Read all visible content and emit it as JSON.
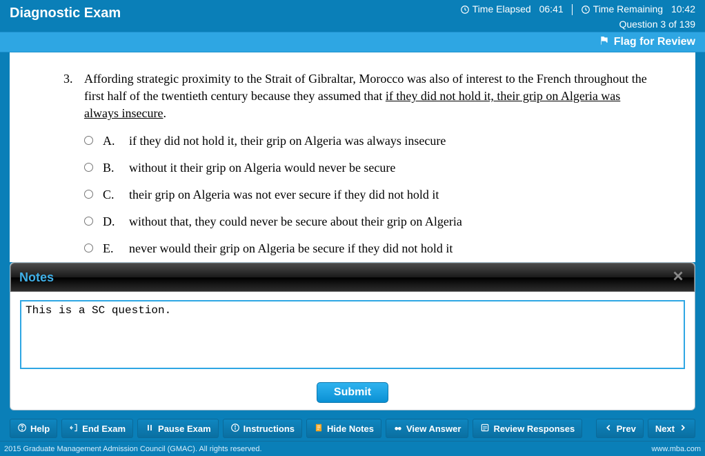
{
  "header": {
    "title": "Diagnostic Exam",
    "time_elapsed_label": "Time Elapsed",
    "time_elapsed_value": "06:41",
    "time_remaining_label": "Time Remaining",
    "time_remaining_value": "10:42",
    "question_counter": "Question 3 of 139"
  },
  "flag_bar": {
    "label": "Flag for Review"
  },
  "question": {
    "number": "3.",
    "stem_pre": "Affording strategic proximity to the Strait of Gibraltar, Morocco was also of interest to the French throughout the first half of the twentieth century because they assumed that ",
    "stem_underlined": "if they did not hold it, their grip on Algeria was always insecure",
    "stem_post": ".",
    "choices": [
      {
        "label": "A.",
        "text": "if they did not hold it, their grip on Algeria was always insecure"
      },
      {
        "label": "B.",
        "text": "without it their grip on Algeria would never be secure"
      },
      {
        "label": "C.",
        "text": "their grip on Algeria was not ever secure if they did not hold it"
      },
      {
        "label": "D.",
        "text": "without that, they could never be secure about their grip on Algeria"
      },
      {
        "label": "E.",
        "text": "never would their grip on Algeria be secure if they did not hold it"
      }
    ]
  },
  "notes": {
    "title": "Notes",
    "content": "This is a SC question.",
    "submit_label": "Submit"
  },
  "toolbar": {
    "help": "Help",
    "end_exam": "End Exam",
    "pause_exam": "Pause Exam",
    "instructions": "Instructions",
    "hide_notes": "Hide Notes",
    "view_answer": "View Answer",
    "review_responses": "Review Responses",
    "prev": "Prev",
    "next": "Next"
  },
  "footer": {
    "copyright": "2015 Graduate Management Admission Council (GMAC). All rights reserved.",
    "url": "www.mba.com"
  }
}
